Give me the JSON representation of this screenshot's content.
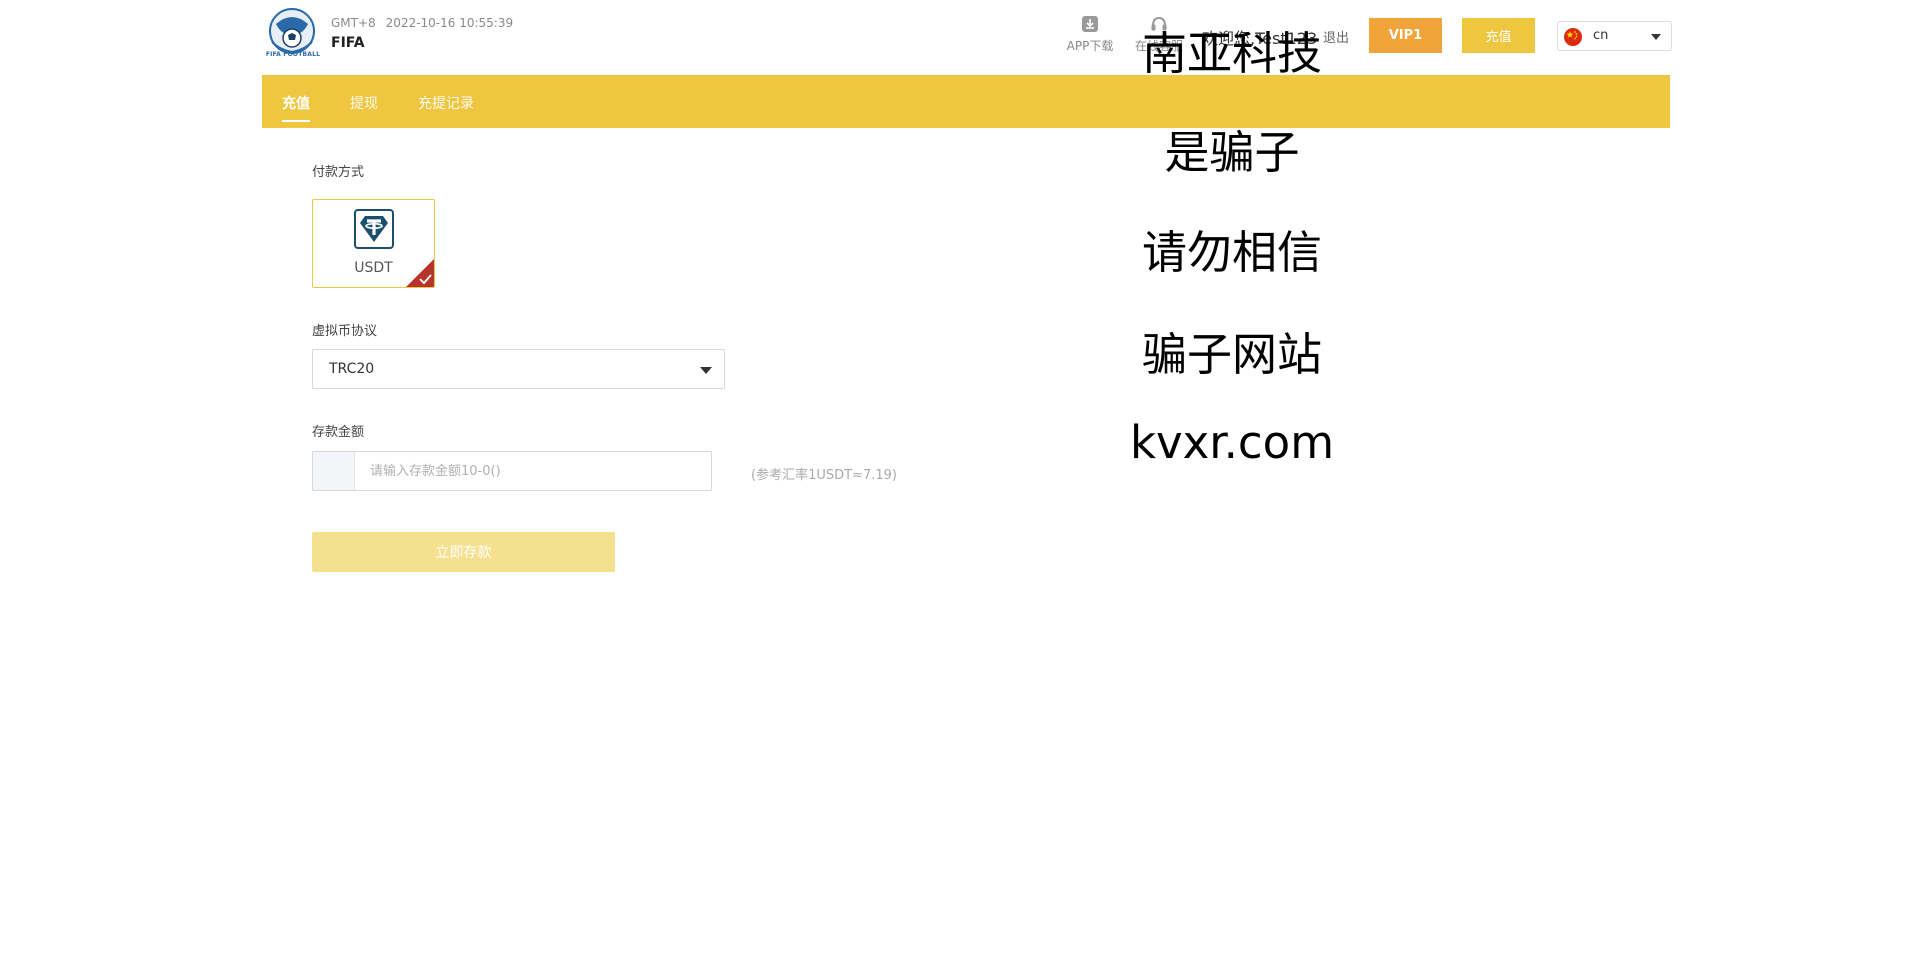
{
  "header": {
    "logo_text": "FIFA FOOTBALL",
    "timezone": "GMT+8",
    "datetime": "2022-10-16 10:55:39",
    "site_name": "FIFA",
    "app_download_label": "APP下载",
    "online_service_label": "在线客服",
    "welcome_text": "欢迎您,Test123",
    "logout_label": "退出",
    "vip_label": "VIP1",
    "recharge_label": "充值",
    "language": "cn"
  },
  "tabs": [
    {
      "label": "充值",
      "active": true
    },
    {
      "label": "提现",
      "active": false
    },
    {
      "label": "充提记录",
      "active": false
    }
  ],
  "form": {
    "payment_method_label": "付款方式",
    "payment_option": "USDT",
    "protocol_label": "虚拟币协议",
    "protocol_value": "TRC20",
    "amount_label": "存款金额",
    "amount_placeholder": "请输入存款金额10-0()",
    "rate_note": "(参考汇率1USDT≈7.19)",
    "submit_label": "立即存款"
  },
  "overlay_text": [
    "南亚科技",
    "是骗子",
    "请勿相信",
    "骗子网站",
    "kvxr.com"
  ],
  "colors": {
    "accent_yellow": "#eec640",
    "vip_orange": "#f0a43a",
    "submit_disabled": "#f5e08f",
    "tether_blue": "#1a4f6e",
    "check_red": "#b5352d"
  },
  "icons": {
    "logo": "fifa-football-logo",
    "app_download": "download-icon",
    "online_service": "headset-icon",
    "flag": "china-flag-icon",
    "payment": "tether-icon",
    "selected_check": "check-icon"
  }
}
